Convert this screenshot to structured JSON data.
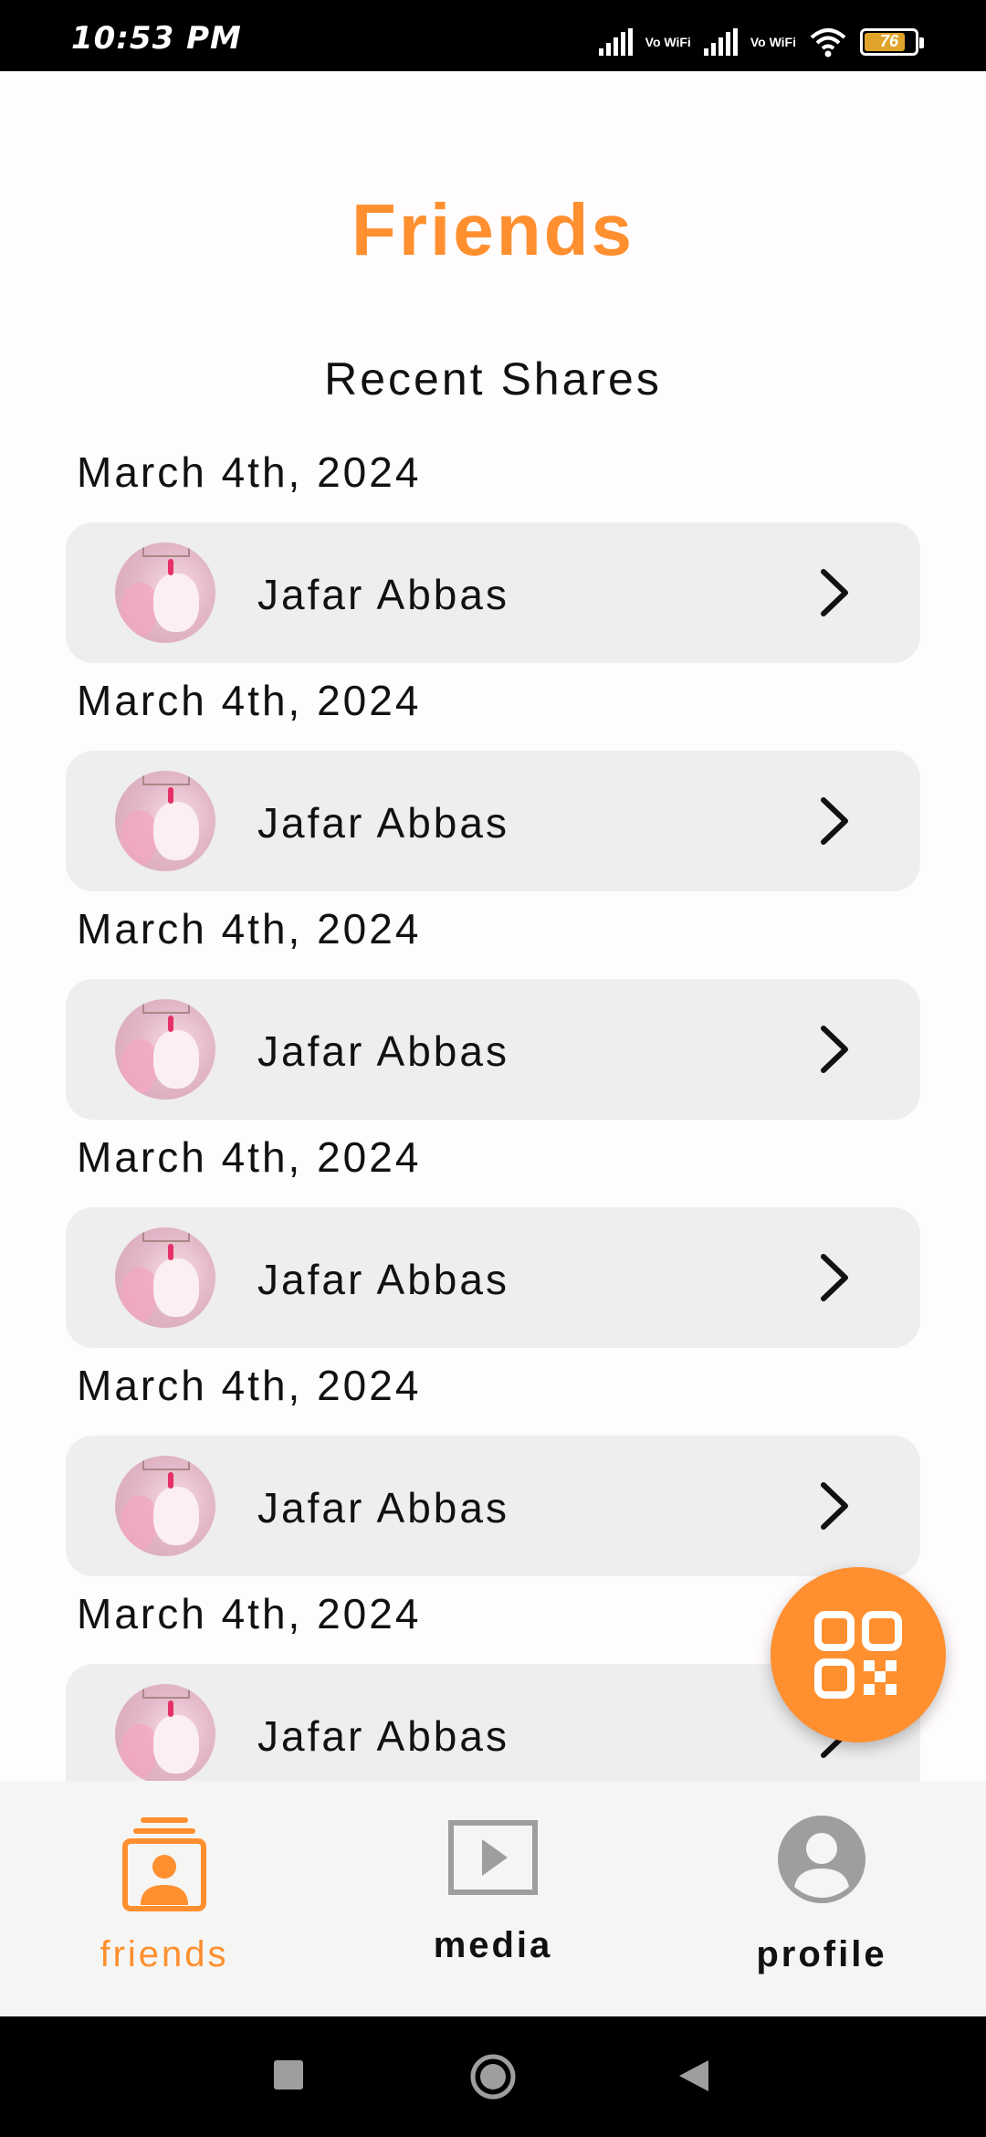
{
  "status_bar": {
    "time": "10:53 PM",
    "network_label_1": "Vo WiFi",
    "network_label_2": "Vo WiFi",
    "battery_level": "76",
    "icons": [
      "signal-icon",
      "vowifi-icon",
      "signal-icon",
      "vowifi-icon",
      "wifi-icon",
      "battery-icon"
    ]
  },
  "header": {
    "title": "Friends",
    "section_title": "Recent Shares"
  },
  "shares": [
    {
      "date": "March 4th, 2024",
      "name": "Jafar Abbas"
    },
    {
      "date": "March 4th, 2024",
      "name": "Jafar Abbas"
    },
    {
      "date": "March 4th, 2024",
      "name": "Jafar Abbas"
    },
    {
      "date": "March 4th, 2024",
      "name": "Jafar Abbas"
    },
    {
      "date": "March 4th, 2024",
      "name": "Jafar Abbas"
    },
    {
      "date": "March 4th, 2024",
      "name": "Jafar Abbas"
    }
  ],
  "fab": {
    "icon": "qr-code-icon"
  },
  "bottom_nav": {
    "items": [
      {
        "label": "friends",
        "icon": "friends-icon",
        "active": true
      },
      {
        "label": "media",
        "icon": "media-play-icon",
        "active": false
      },
      {
        "label": "profile",
        "icon": "profile-icon",
        "active": false
      }
    ]
  },
  "system_nav": {
    "icons": [
      "recents-icon",
      "home-icon",
      "back-icon"
    ]
  },
  "colors": {
    "accent": "#ff8f2f",
    "card_background": "#eeeeee",
    "page_background": "#fffcfe",
    "nav_background": "#f5f5f3"
  }
}
